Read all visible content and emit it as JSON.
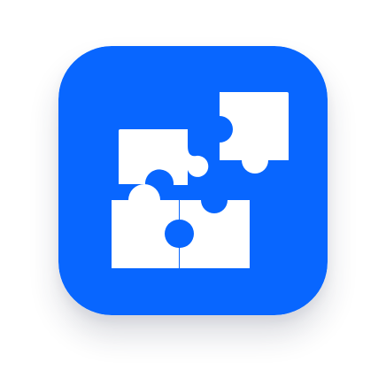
{
  "app_icon": {
    "icon": "puzzle-pieces-icon",
    "background_color": "#0866FF",
    "glyph_color": "#FFFFFF"
  }
}
